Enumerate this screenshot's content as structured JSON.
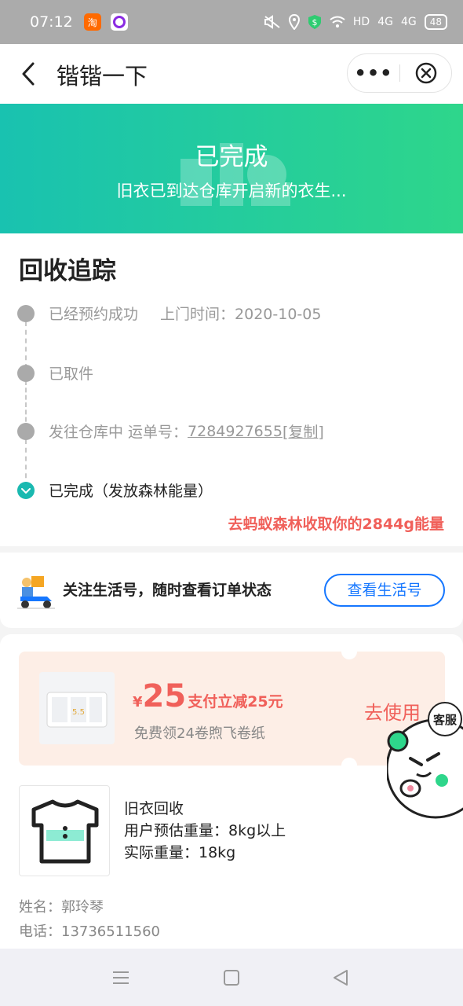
{
  "status_bar": {
    "time": "07:12",
    "network": "HD",
    "signal1": "4G",
    "signal2": "4G",
    "battery": "48"
  },
  "nav": {
    "title": "锴锴一下",
    "more": "•••"
  },
  "banner": {
    "title": "已完成",
    "subtitle": "旧衣已到达仓库开启新的衣生..."
  },
  "tracking": {
    "heading": "回收追踪",
    "steps": [
      {
        "label": "已经预约成功",
        "extra": "上门时间：2020-10-05"
      },
      {
        "label": "已取件"
      },
      {
        "label": "发往仓库中 运单号：",
        "waybill": "7284927655",
        "copy": "[复制]"
      },
      {
        "label": "已完成（发放森林能量）"
      }
    ],
    "energy_link": "去蚂蚁森林收取你的2844g能量"
  },
  "follow": {
    "text": "关注生活号，随时查看订单状态",
    "button": "查看生活号"
  },
  "coupon": {
    "currency": "¥",
    "amount": "25",
    "desc": "支付立减25元",
    "sub": "免费领24卷煦飞卷纸",
    "use": "去使用"
  },
  "item": {
    "name": "旧衣回收",
    "est_weight": "用户预估重量：8kg以上",
    "actual_weight": "实际重量：18kg"
  },
  "contact": {
    "name": "姓名：郭玲琴",
    "phone": "电话：13736511560"
  },
  "service": {
    "label": "客服"
  },
  "colors": {
    "accent_blue": "#1677ff",
    "accent_red": "#f0605a",
    "banner_start": "#19c2b0",
    "banner_end": "#2ed68b",
    "done_dot": "#1ab9b0"
  }
}
